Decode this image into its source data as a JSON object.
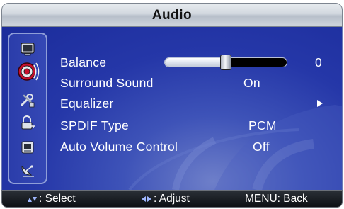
{
  "title": "Audio",
  "colors": {
    "panel_blue": "#2537a8",
    "selection_accent": "#c8102e",
    "text": "#ffffff",
    "footer_bg": "#0d1014"
  },
  "side_menu": {
    "items": [
      {
        "name": "picture",
        "icon": "tv-screen-icon",
        "selected": false
      },
      {
        "name": "audio",
        "icon": "speaker-icon",
        "selected": true
      },
      {
        "name": "setup",
        "icon": "tools-icon",
        "selected": false
      },
      {
        "name": "lock",
        "icon": "lock-key-icon",
        "selected": false
      },
      {
        "name": "input",
        "icon": "input-source-icon",
        "selected": false
      },
      {
        "name": "channel",
        "icon": "satellite-dish-icon",
        "selected": false
      }
    ]
  },
  "menu": {
    "balance": {
      "label": "Balance",
      "value": "0",
      "slider_fraction": 0.5
    },
    "surround": {
      "label": "Surround Sound",
      "value": "On"
    },
    "equalizer": {
      "label": "Equalizer",
      "arrow": "right-arrow-icon"
    },
    "spdif": {
      "label": "SPDIF Type",
      "value": "PCM"
    },
    "auto_volume": {
      "label": "Auto Volume Control",
      "value": "Off"
    }
  },
  "footer": {
    "select": {
      "icon": "up-down-arrows-icon",
      "text": ": Select"
    },
    "adjust": {
      "icon": "left-right-arrows-icon",
      "text": ": Adjust"
    },
    "back": {
      "text": "MENU: Back"
    }
  }
}
